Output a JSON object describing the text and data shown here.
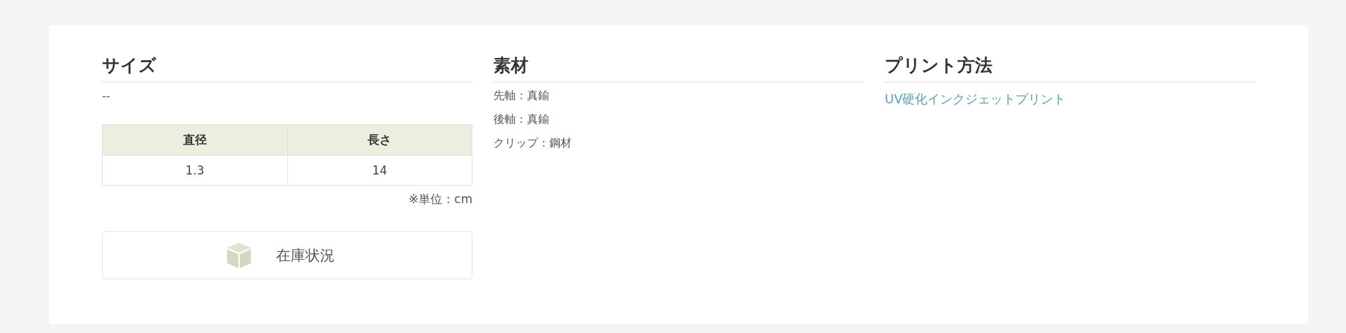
{
  "sections": [
    {
      "kind": "size",
      "title": "サイズ",
      "value": "--",
      "table": {
        "columns": [
          "直径",
          "長さ"
        ],
        "rows": [
          [
            "1.3",
            "14"
          ]
        ]
      },
      "note": "※単位：cm",
      "stock_button": "在庫状況"
    },
    {
      "kind": "lines",
      "title": "素材",
      "lines": [
        "先軸：真鍮",
        "後軸：真鍮",
        "クリップ：鋼材"
      ]
    },
    {
      "kind": "link",
      "title": "プリント方法",
      "link": "UV硬化インクジェットプリント"
    }
  ]
}
